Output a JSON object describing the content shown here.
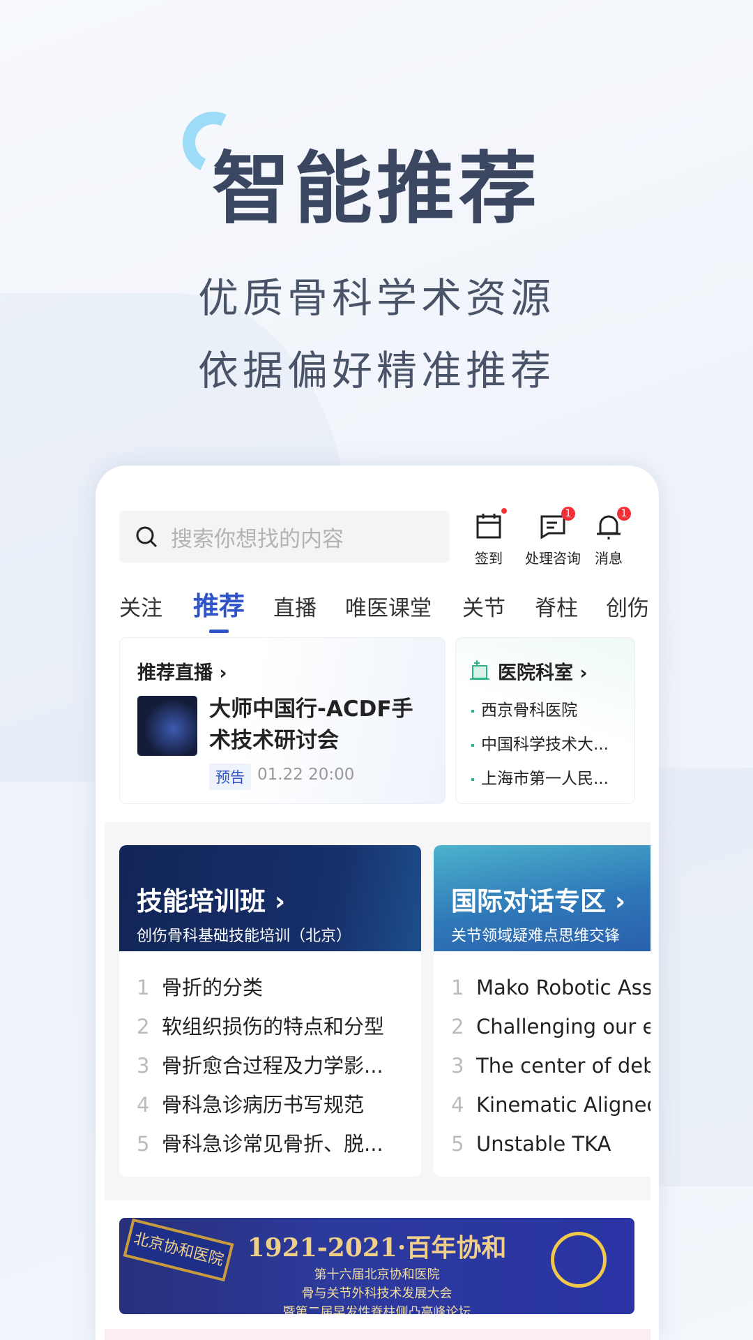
{
  "hero": {
    "title": "智能推荐",
    "subtitle_lines": [
      "优质骨科学术资源",
      "依据偏好精准推荐"
    ]
  },
  "search": {
    "placeholder": "搜索你想找的内容",
    "icon": "search-icon"
  },
  "top_actions": [
    {
      "label": "签到",
      "icon": "calendar-icon",
      "badge": "dot"
    },
    {
      "label": "处理咨询",
      "icon": "message-icon",
      "badge": "1"
    },
    {
      "label": "消息",
      "icon": "bell-icon",
      "badge": "1"
    }
  ],
  "tabs": [
    {
      "label": "关注"
    },
    {
      "label": "推荐",
      "active": true
    },
    {
      "label": "直播"
    },
    {
      "label": "唯医课堂"
    },
    {
      "label": "关节"
    },
    {
      "label": "脊柱"
    },
    {
      "label": "创伤"
    }
  ],
  "live": {
    "header": "推荐直播 ›",
    "title": "大师中国行-ACDF手术技术研讨会",
    "tag": "预告",
    "time": "01.22 20:00"
  },
  "hospital": {
    "header": "医院科室 ›",
    "items": [
      "西京骨科医院",
      "中国科学技术大...",
      "上海市第一人民..."
    ]
  },
  "courses": [
    {
      "title": "技能培训班 ›",
      "subtitle": "创伤骨科基础技能培训（北京）",
      "items": [
        "骨折的分类",
        "软组织损伤的特点和分型",
        "骨折愈合过程及力学影...",
        "骨科急诊病历书写规范",
        "骨科急诊常见骨折、脱..."
      ]
    },
    {
      "title": "国际对话专区 ›",
      "subtitle": "关节领域疑难点思维交锋",
      "items": [
        "Mako Robotic Assisted",
        "Challenging our e",
        "The center of deb",
        "Kinematic Aligned",
        "Unstable TKA"
      ]
    }
  ],
  "banner": {
    "headline": "1921-2021·百年协和",
    "lines": [
      "第十六届北京协和医院",
      "骨与关节外科技术发展大会",
      "暨第二届早发性脊柱侧凸高峰论坛"
    ],
    "plaque": "北京协和医院"
  },
  "colors": {
    "accent": "#2f54c8",
    "badge": "#f0323a",
    "hero_text": "#3b4760"
  }
}
